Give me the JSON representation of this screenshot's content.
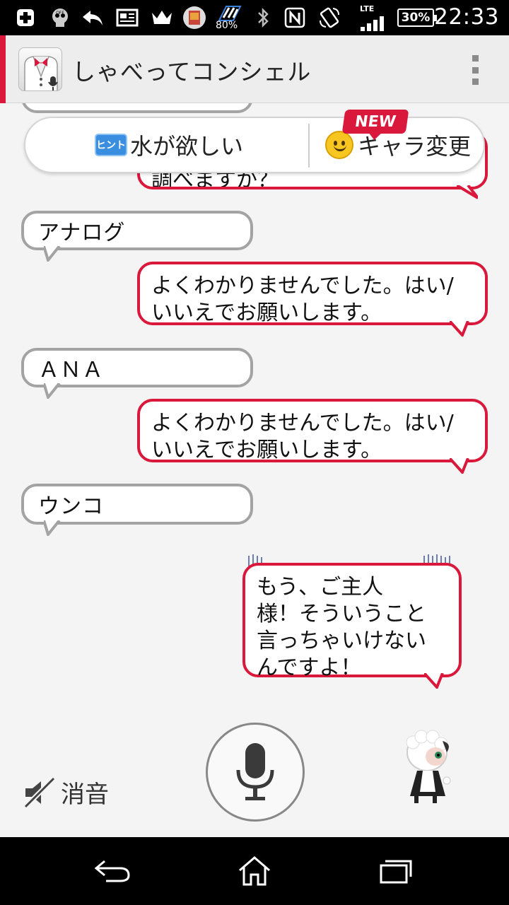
{
  "status_bar": {
    "time": "22:33",
    "battery": "30%",
    "percent_80": "80%",
    "network": "LTE",
    "icons": [
      "plus-icon",
      "off-icon",
      "back-arrow-icon",
      "news-icon",
      "crown-icon",
      "app-thumb-icon",
      "data-icon",
      "bluetooth-icon",
      "nfc-icon",
      "rotation-icon",
      "signal-icon",
      "battery-icon"
    ]
  },
  "action_bar": {
    "title": "しゃべってコンシェル",
    "icon": "butler-mic-icon",
    "menu_icon": "overflow-menu-icon"
  },
  "hint_bar": {
    "hint_badge": "ヒント",
    "hint_text": "水が欲しい",
    "new_badge": "NEW",
    "character_change": "キャラ変更"
  },
  "chat": {
    "clipped_top_bot_fragment": "調べますか？",
    "messages": [
      {
        "role": "user",
        "text": "アナログ"
      },
      {
        "role": "bot",
        "line1": "よくわかりませんでした。はい/",
        "line2": "いいえでお願いします。"
      },
      {
        "role": "user",
        "text": "ＡＮＡ"
      },
      {
        "role": "bot",
        "line1": "よくわかりませんでした。はい/",
        "line2": "いいえでお願いします。"
      },
      {
        "role": "user",
        "text": "ウンコ"
      },
      {
        "role": "bot",
        "line1": "もう、ご主人",
        "line2": "様！そういうこと",
        "line3": "言っちゃいけない",
        "line4": "んですよ！"
      }
    ]
  },
  "controls": {
    "mute_label": "消音",
    "mute_icon": "speaker-muted-icon",
    "mic_icon": "microphone-icon",
    "character_icon": "sheep-maid-character"
  },
  "colors": {
    "accent": "#d9183b",
    "user_border": "#a3a3a3",
    "background": "#f4f4f4"
  }
}
